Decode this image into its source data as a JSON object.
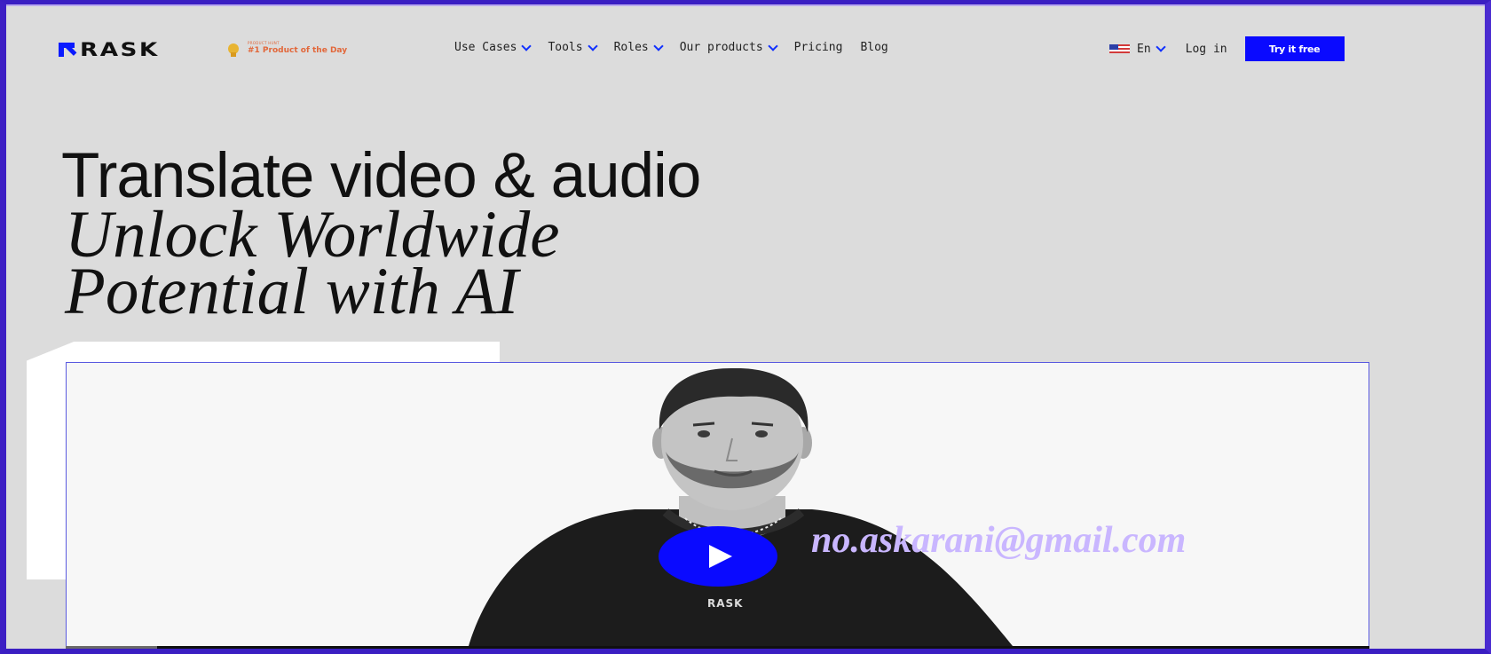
{
  "nav": {
    "logo_text": "RASK",
    "badge": {
      "top_text": "PRODUCT HUNT",
      "main_text": "#1 Product of the Day"
    },
    "menu": [
      {
        "label": "Use Cases",
        "dropdown": true
      },
      {
        "label": "Tools",
        "dropdown": true
      },
      {
        "label": "Roles",
        "dropdown": true
      },
      {
        "label": "Our products",
        "dropdown": true
      },
      {
        "label": "Pricing",
        "dropdown": false
      },
      {
        "label": "Blog",
        "dropdown": false
      }
    ],
    "language": "En",
    "login_label": "Log in",
    "cta_label": "Try it free"
  },
  "hero": {
    "line1": "Translate video & audio",
    "line2": "Unlock Worldwide",
    "line3": "Potential with AI"
  },
  "video": {
    "shirt_logo": "RASK",
    "watermark": "no.askarani@gmail.com",
    "progress": 0.07
  },
  "colors": {
    "accent": "#0a0aff",
    "background": "#dcdcdc",
    "frame": "#3d1fc4"
  },
  "icons": [
    "logo-icon",
    "medal-icon",
    "chevron-down-icon",
    "flag-us-icon",
    "play-icon"
  ]
}
